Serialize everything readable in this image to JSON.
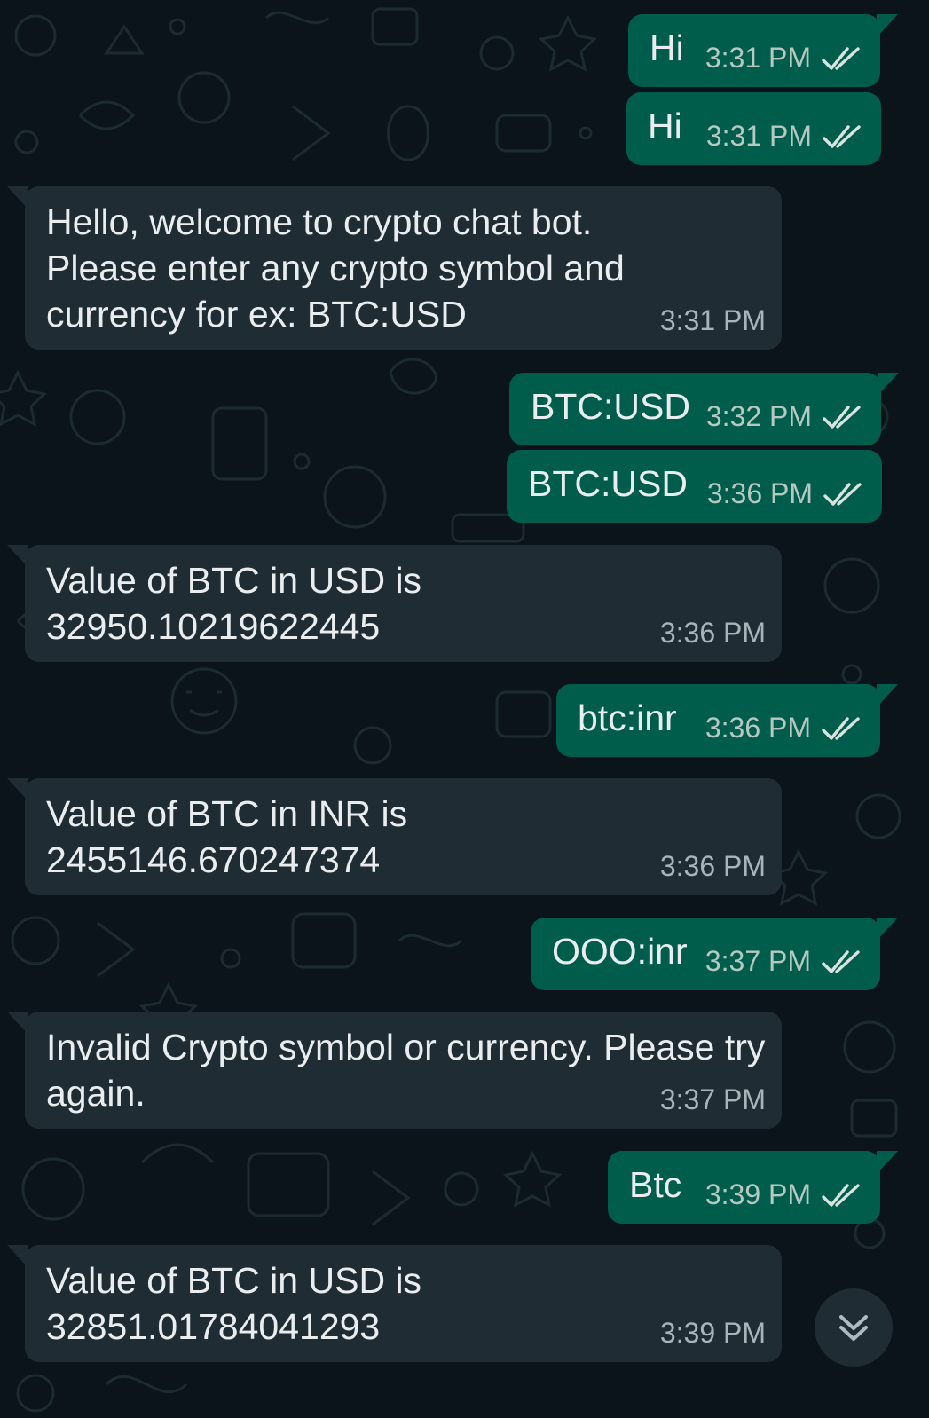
{
  "colors": {
    "background": "#0b141a",
    "outgoing_bubble": "#005c4b",
    "incoming_bubble": "#202c33",
    "text": "#e9edef",
    "timestamp": "#a8b3ba",
    "read_ticks": "#d9e4e1"
  },
  "messages": [
    {
      "direction": "outgoing",
      "text": "Hi",
      "time": "3:31 PM",
      "status_icon": "double-check-icon"
    },
    {
      "direction": "outgoing",
      "text": "Hi",
      "time": "3:31 PM",
      "status_icon": "double-check-icon"
    },
    {
      "direction": "incoming",
      "text": "Hello, welcome to crypto chat bot. Please enter any crypto symbol and currency for ex: BTC:USD",
      "time": "3:31 PM"
    },
    {
      "direction": "outgoing",
      "text": "BTC:USD",
      "time": "3:32 PM",
      "status_icon": "double-check-icon"
    },
    {
      "direction": "outgoing",
      "text": "BTC:USD",
      "time": "3:36 PM",
      "status_icon": "double-check-icon"
    },
    {
      "direction": "incoming",
      "text": "Value of BTC in USD is 32950.10219622445",
      "time": "3:36 PM"
    },
    {
      "direction": "outgoing",
      "text": "btc:inr",
      "time": "3:36 PM",
      "status_icon": "double-check-icon"
    },
    {
      "direction": "incoming",
      "text": "Value of BTC in INR is 2455146.670247374",
      "time": "3:36 PM"
    },
    {
      "direction": "outgoing",
      "text": "OOO:inr",
      "time": "3:37 PM",
      "status_icon": "double-check-icon"
    },
    {
      "direction": "incoming",
      "text": "Invalid Crypto symbol or currency. Please try again.",
      "time": "3:37 PM"
    },
    {
      "direction": "outgoing",
      "text": "Btc",
      "time": "3:39 PM",
      "status_icon": "double-check-icon"
    },
    {
      "direction": "incoming",
      "text": "Value of BTC in USD is 32851.01784041293",
      "time": "3:39 PM"
    }
  ],
  "scroll_button": {
    "icon": "double-chevron-down-icon"
  }
}
